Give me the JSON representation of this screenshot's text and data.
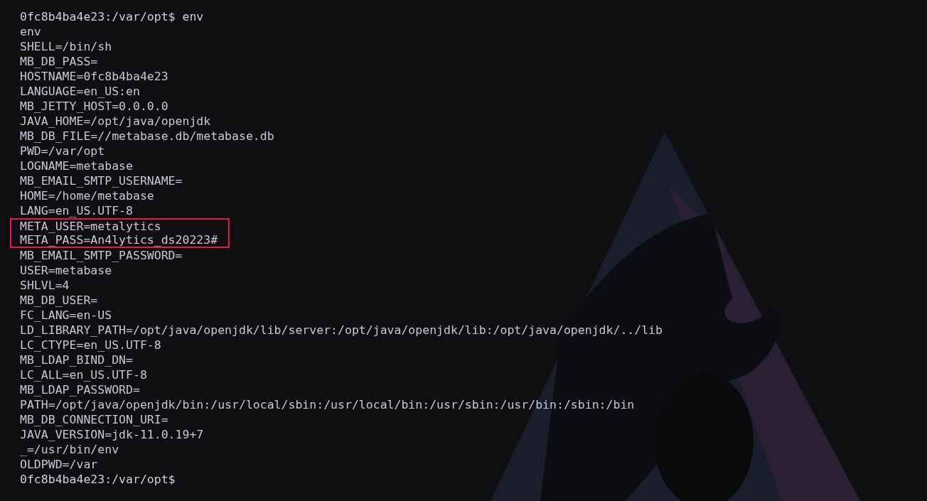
{
  "terminal": {
    "lines": [
      {
        "kind": "prompt",
        "text": "0fc8b4ba4e23:/var/opt$ env",
        "highlighted": false
      },
      {
        "kind": "output",
        "text": "env",
        "highlighted": false
      },
      {
        "kind": "output",
        "text": "SHELL=/bin/sh",
        "highlighted": false
      },
      {
        "kind": "output",
        "text": "MB_DB_PASS=",
        "highlighted": false
      },
      {
        "kind": "output",
        "text": "HOSTNAME=0fc8b4ba4e23",
        "highlighted": false
      },
      {
        "kind": "output",
        "text": "LANGUAGE=en_US:en",
        "highlighted": false
      },
      {
        "kind": "output",
        "text": "MB_JETTY_HOST=0.0.0.0",
        "highlighted": false
      },
      {
        "kind": "output",
        "text": "JAVA_HOME=/opt/java/openjdk",
        "highlighted": false
      },
      {
        "kind": "output",
        "text": "MB_DB_FILE=//metabase.db/metabase.db",
        "highlighted": false
      },
      {
        "kind": "output",
        "text": "PWD=/var/opt",
        "highlighted": false
      },
      {
        "kind": "output",
        "text": "LOGNAME=metabase",
        "highlighted": false
      },
      {
        "kind": "output",
        "text": "MB_EMAIL_SMTP_USERNAME=",
        "highlighted": false
      },
      {
        "kind": "output",
        "text": "HOME=/home/metabase",
        "highlighted": false
      },
      {
        "kind": "output",
        "text": "LANG=en_US.UTF-8",
        "highlighted": false
      },
      {
        "kind": "output",
        "text": "META_USER=metalytics",
        "highlighted": true
      },
      {
        "kind": "output",
        "text": "META_PASS=An4lytics_ds20223#",
        "highlighted": true
      },
      {
        "kind": "output",
        "text": "MB_EMAIL_SMTP_PASSWORD=",
        "highlighted": false
      },
      {
        "kind": "output",
        "text": "USER=metabase",
        "highlighted": false
      },
      {
        "kind": "output",
        "text": "SHLVL=4",
        "highlighted": false
      },
      {
        "kind": "output",
        "text": "MB_DB_USER=",
        "highlighted": false
      },
      {
        "kind": "output",
        "text": "FC_LANG=en-US",
        "highlighted": false
      },
      {
        "kind": "output",
        "text": "LD_LIBRARY_PATH=/opt/java/openjdk/lib/server:/opt/java/openjdk/lib:/opt/java/openjdk/../lib",
        "highlighted": false
      },
      {
        "kind": "output",
        "text": "LC_CTYPE=en_US.UTF-8",
        "highlighted": false
      },
      {
        "kind": "output",
        "text": "MB_LDAP_BIND_DN=",
        "highlighted": false
      },
      {
        "kind": "output",
        "text": "LC_ALL=en_US.UTF-8",
        "highlighted": false
      },
      {
        "kind": "output",
        "text": "MB_LDAP_PASSWORD=",
        "highlighted": false
      },
      {
        "kind": "output",
        "text": "PATH=/opt/java/openjdk/bin:/usr/local/sbin:/usr/local/bin:/usr/sbin:/usr/bin:/sbin:/bin",
        "highlighted": false
      },
      {
        "kind": "output",
        "text": "MB_DB_CONNECTION_URI=",
        "highlighted": false
      },
      {
        "kind": "output",
        "text": "JAVA_VERSION=jdk-11.0.19+7",
        "highlighted": false
      },
      {
        "kind": "output",
        "text": "_=/usr/bin/env",
        "highlighted": false
      },
      {
        "kind": "output",
        "text": "OLDPWD=/var",
        "highlighted": false
      },
      {
        "kind": "prompt",
        "text": "0fc8b4ba4e23:/var/opt$",
        "highlighted": false
      }
    ]
  }
}
